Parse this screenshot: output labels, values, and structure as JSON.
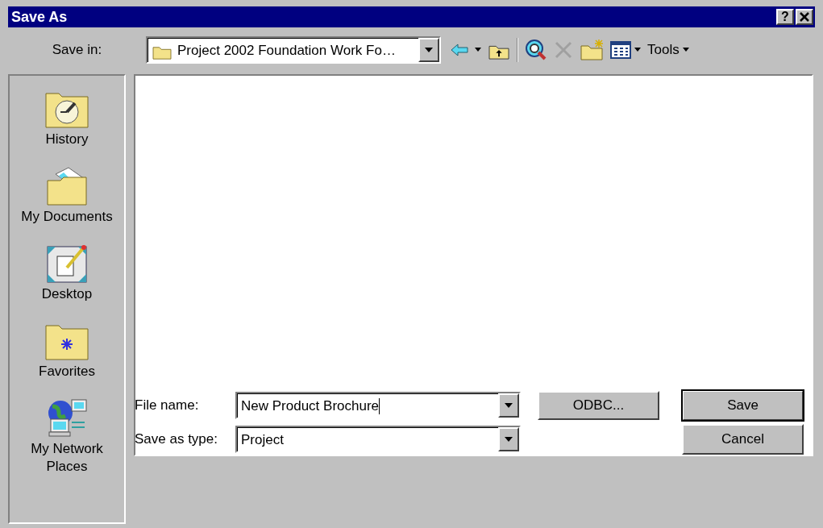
{
  "window": {
    "title": "Save As",
    "help_button": "?"
  },
  "save_in": {
    "label": "Save in:",
    "value": "Project 2002 Foundation Work Fo…"
  },
  "toolbar": {
    "delete_disabled": true,
    "tools": "Tools"
  },
  "places": [
    {
      "label": "History",
      "kind": "history",
      "selected": false
    },
    {
      "label": "My Documents",
      "kind": "documents",
      "selected": false
    },
    {
      "label": "Desktop",
      "kind": "desktop",
      "selected": false
    },
    {
      "label": "Favorites",
      "kind": "favorites",
      "selected": false
    },
    {
      "label": "My Network Places",
      "kind": "network",
      "selected": false
    }
  ],
  "file_name": {
    "label": "File name:",
    "value": "New Product Brochure"
  },
  "file_type": {
    "label": "Save as type:",
    "value": "Project"
  },
  "buttons": [
    {
      "label": "ODBC...",
      "default": false
    },
    {
      "label": "Save",
      "default": true
    },
    {
      "label": "Cancel",
      "default": false
    }
  ]
}
